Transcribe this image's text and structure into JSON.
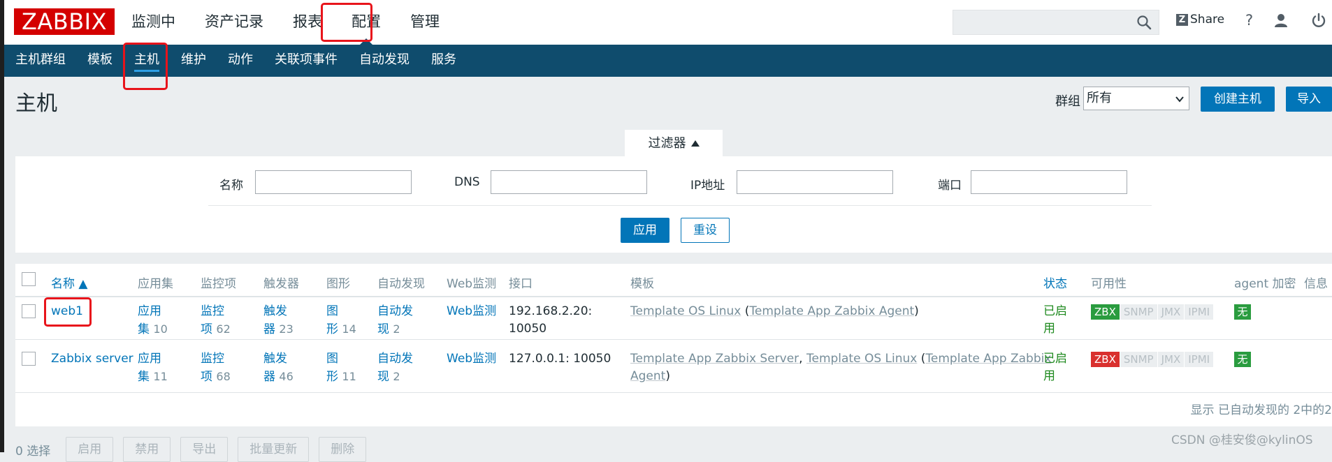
{
  "app": {
    "logo": "ZABBIX"
  },
  "main_nav": [
    {
      "label": "监测中"
    },
    {
      "label": "资产记录"
    },
    {
      "label": "报表"
    },
    {
      "label": "配置"
    },
    {
      "label": "管理"
    }
  ],
  "topbar": {
    "search_value": "",
    "share_icon": "Z",
    "share_label": "Share",
    "help_icon": "?",
    "user_icon": "user-icon",
    "power_icon": "power-icon"
  },
  "sub_nav": [
    {
      "label": "主机群组"
    },
    {
      "label": "模板"
    },
    {
      "label": "主机"
    },
    {
      "label": "维护"
    },
    {
      "label": "动作"
    },
    {
      "label": "关联项事件"
    },
    {
      "label": "自动发现"
    },
    {
      "label": "服务"
    }
  ],
  "page": {
    "title": "主机",
    "group_label": "群组",
    "group_value": "所有",
    "create_button": "创建主机",
    "import_button": "导入"
  },
  "filter": {
    "tab_label": "过滤器",
    "fields": [
      {
        "label": "名称",
        "value": ""
      },
      {
        "label": "DNS",
        "value": ""
      },
      {
        "label": "IP地址",
        "value": ""
      },
      {
        "label": "端口",
        "value": ""
      }
    ],
    "apply": "应用",
    "reset": "重设"
  },
  "table": {
    "headers": [
      "名称 ▲",
      "应用集",
      "监控项",
      "触发器",
      "图形",
      "自动发现",
      "Web监测",
      "接口",
      "模板",
      "状态",
      "可用性",
      "agent 加密",
      "信息"
    ],
    "rows": [
      {
        "name": "web1",
        "apps_a": "应用",
        "apps_b": "集",
        "apps_n": "10",
        "items_a": "监控",
        "items_b": "项",
        "items_n": "62",
        "triggers_a": "触发",
        "triggers_b": "器",
        "triggers_n": "23",
        "graphs_a": "图",
        "graphs_b": "形",
        "graphs_n": "14",
        "disc_a": "自动发",
        "disc_b": "现",
        "disc_n": "2",
        "web": "Web监测",
        "iface_l1": "192.168.2.20:",
        "iface_l2": "10050",
        "tpl_1": "Template OS Linux",
        "tpl_sep1": " (",
        "tpl_2": "Template App Zabbix Agent",
        "tpl_end": ")",
        "status_a": "已启",
        "status_b": "用",
        "zbx": "ZBX",
        "snmp": "SNMP",
        "jmx": "JMX",
        "ipmi": "IPMI",
        "zbx_state": "available",
        "encryption": "无"
      },
      {
        "name": "Zabbix server",
        "apps_a": "应用",
        "apps_b": "集",
        "apps_n": "11",
        "items_a": "监控",
        "items_b": "项",
        "items_n": "68",
        "triggers_a": "触发",
        "triggers_b": "器",
        "triggers_n": "46",
        "graphs_a": "图",
        "graphs_b": "形",
        "graphs_n": "11",
        "disc_a": "自动发",
        "disc_b": "现",
        "disc_n": "2",
        "web": "Web监测",
        "iface_l1": "127.0.0.1: 10050",
        "tpl_1": "Template App Zabbix Server",
        "tpl_sep1": ", ",
        "tpl_2": "Template OS Linux",
        "tpl_sep2": " (",
        "tpl_3a": "Template App Zabbix",
        "tpl_3b": "Agent",
        "tpl_end": ")",
        "status_a": "已启",
        "status_b": "用",
        "zbx": "ZBX",
        "snmp": "SNMP",
        "jmx": "JMX",
        "ipmi": "IPMI",
        "zbx_state": "unavailable",
        "encryption": "无"
      }
    ],
    "footer": "显示 已自动发现的 2中的2"
  },
  "actions": {
    "selected": "0 选择",
    "buttons": [
      "启用",
      "禁用",
      "导出",
      "批量更新",
      "删除"
    ]
  },
  "watermark": "CSDN @桂安俊@kylinOS",
  "colors": {
    "brand": "#d40000",
    "nav_bg": "#0f4c6d",
    "accent": "#0275b8",
    "highlight": "#e8141b"
  }
}
